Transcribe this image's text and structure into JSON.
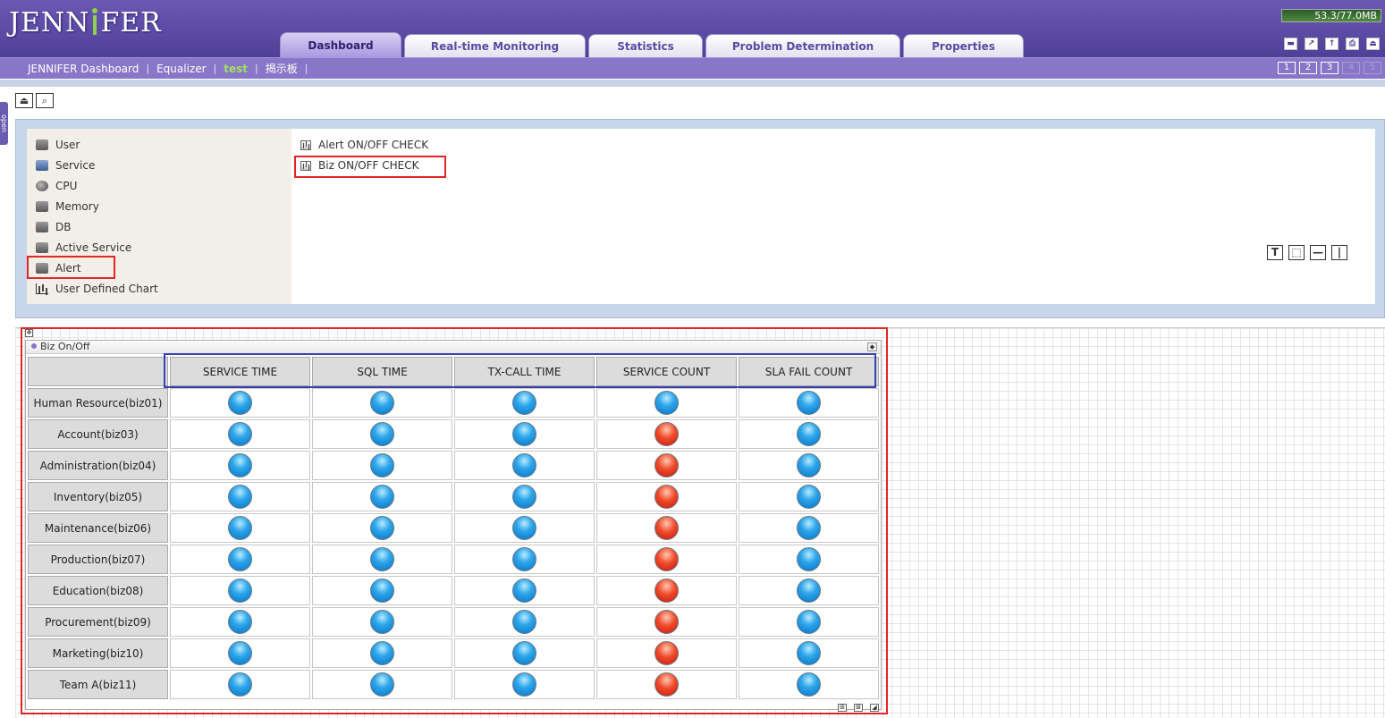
{
  "header": {
    "logo_text": "JENNIFER",
    "memory": "53.3/77.0MB",
    "tabs": [
      {
        "label": "Dashboard",
        "active": true
      },
      {
        "label": "Real-time Monitoring"
      },
      {
        "label": "Statistics"
      },
      {
        "label": "Problem Determination"
      },
      {
        "label": "Properties"
      }
    ],
    "icons": [
      "minimize-icon",
      "popout-icon",
      "upload-icon",
      "print-icon",
      "logout-icon"
    ]
  },
  "subnav": {
    "items": [
      "JENNIFER Dashboard",
      "Equalizer",
      "test",
      "揭示板"
    ],
    "active": "test",
    "pages": [
      "1",
      "2",
      "3",
      "4",
      "5"
    ]
  },
  "sidebar_toggle": "open",
  "menu": {
    "items": [
      "User",
      "Service",
      "CPU",
      "Memory",
      "DB",
      "Active Service",
      "Alert",
      "User Defined Chart"
    ],
    "selected": "Alert"
  },
  "submenu": {
    "items": [
      "Alert ON/OFF CHECK",
      "Biz ON/OFF CHECK"
    ],
    "selected": "Biz ON/OFF CHECK"
  },
  "draw_tools": [
    "T",
    "⬚",
    "—",
    "|"
  ],
  "widget": {
    "title": "Biz On/Off",
    "columns": [
      "SERVICE TIME",
      "SQL TIME",
      "TX-CALL TIME",
      "SERVICE COUNT",
      "SLA FAIL COUNT"
    ],
    "rows": [
      {
        "name": "Human Resource(biz01)",
        "status": [
          "blue",
          "blue",
          "blue",
          "blue",
          "blue"
        ]
      },
      {
        "name": "Account(biz03)",
        "status": [
          "blue",
          "blue",
          "blue",
          "red",
          "blue"
        ]
      },
      {
        "name": "Administration(biz04)",
        "status": [
          "blue",
          "blue",
          "blue",
          "red",
          "blue"
        ]
      },
      {
        "name": "Inventory(biz05)",
        "status": [
          "blue",
          "blue",
          "blue",
          "red",
          "blue"
        ]
      },
      {
        "name": "Maintenance(biz06)",
        "status": [
          "blue",
          "blue",
          "blue",
          "red",
          "blue"
        ]
      },
      {
        "name": "Production(biz07)",
        "status": [
          "blue",
          "blue",
          "blue",
          "red",
          "blue"
        ]
      },
      {
        "name": "Education(biz08)",
        "status": [
          "blue",
          "blue",
          "blue",
          "red",
          "blue"
        ]
      },
      {
        "name": "Procurement(biz09)",
        "status": [
          "blue",
          "blue",
          "blue",
          "red",
          "blue"
        ]
      },
      {
        "name": "Marketing(biz10)",
        "status": [
          "blue",
          "blue",
          "blue",
          "red",
          "blue"
        ]
      },
      {
        "name": "Team A(biz11)",
        "status": [
          "blue",
          "blue",
          "blue",
          "red",
          "blue"
        ]
      }
    ]
  },
  "colors": {
    "header": "#5b4aa3",
    "highlight_red": "#e12626",
    "highlight_blue": "#3b3fb4",
    "ok": "#1e90e0",
    "alert": "#e23b20"
  }
}
